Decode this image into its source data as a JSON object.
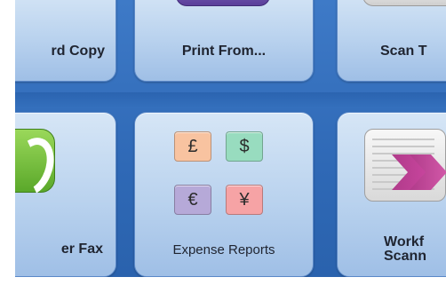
{
  "tiles": {
    "copy": {
      "label": "rd Copy"
    },
    "print_from": {
      "label": "Print From..."
    },
    "scan": {
      "label": "Scan T"
    },
    "fax": {
      "label": "er Fax"
    },
    "expense_reports": {
      "label": "Expense Reports",
      "currencies": [
        {
          "symbol": "£",
          "color": "#f8c3a0"
        },
        {
          "symbol": "$",
          "color": "#98dcbf"
        },
        {
          "symbol": "€",
          "color": "#b6a9d8"
        },
        {
          "symbol": "¥",
          "color": "#f6a3a5"
        }
      ]
    },
    "workflow": {
      "label_line1": "Workf",
      "label_line2": "Scann"
    }
  }
}
